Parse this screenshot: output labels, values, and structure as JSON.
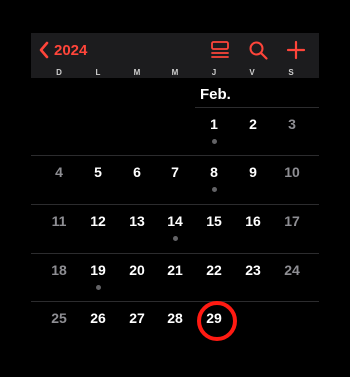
{
  "toolbar": {
    "year": "2024",
    "back_icon": "chevron-left-icon",
    "list_icon": "list-view-icon",
    "search_icon": "search-icon",
    "add_icon": "plus-icon",
    "accent_color": "#ff453a"
  },
  "weekdays": [
    "D",
    "L",
    "M",
    "M",
    "J",
    "V",
    "S"
  ],
  "month_label": "Feb.",
  "weeks": [
    {
      "days": [
        {
          "label": "",
          "weekend": false
        },
        {
          "label": "",
          "weekend": false
        },
        {
          "label": "",
          "weekend": false
        },
        {
          "label": "",
          "weekend": false
        },
        {
          "label": "1",
          "weekend": false,
          "event": true
        },
        {
          "label": "2",
          "weekend": false
        },
        {
          "label": "3",
          "weekend": true
        }
      ]
    },
    {
      "days": [
        {
          "label": "4",
          "weekend": true
        },
        {
          "label": "5",
          "weekend": false
        },
        {
          "label": "6",
          "weekend": false
        },
        {
          "label": "7",
          "weekend": false
        },
        {
          "label": "8",
          "weekend": false,
          "event": true
        },
        {
          "label": "9",
          "weekend": false
        },
        {
          "label": "10",
          "weekend": true
        }
      ]
    },
    {
      "days": [
        {
          "label": "11",
          "weekend": true
        },
        {
          "label": "12",
          "weekend": false
        },
        {
          "label": "13",
          "weekend": false
        },
        {
          "label": "14",
          "weekend": false,
          "event": true
        },
        {
          "label": "15",
          "weekend": false
        },
        {
          "label": "16",
          "weekend": false
        },
        {
          "label": "17",
          "weekend": true
        }
      ]
    },
    {
      "days": [
        {
          "label": "18",
          "weekend": true
        },
        {
          "label": "19",
          "weekend": false,
          "event": true
        },
        {
          "label": "20",
          "weekend": false
        },
        {
          "label": "21",
          "weekend": false
        },
        {
          "label": "22",
          "weekend": false
        },
        {
          "label": "23",
          "weekend": false
        },
        {
          "label": "24",
          "weekend": true
        }
      ]
    },
    {
      "days": [
        {
          "label": "25",
          "weekend": true
        },
        {
          "label": "26",
          "weekend": false
        },
        {
          "label": "27",
          "weekend": false
        },
        {
          "label": "28",
          "weekend": false
        },
        {
          "label": "29",
          "weekend": false,
          "today": true
        },
        {
          "label": "",
          "weekend": false
        },
        {
          "label": "",
          "weekend": false
        }
      ]
    }
  ],
  "today_ring_color": "#ff1a12"
}
